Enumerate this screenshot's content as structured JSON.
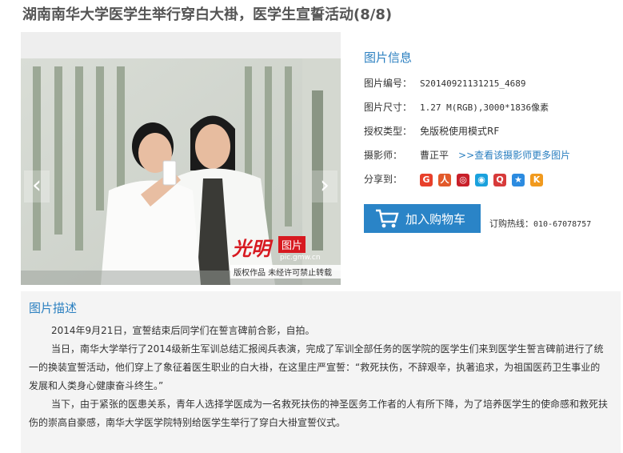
{
  "page": {
    "title": "湖南南华大学医学生举行穿白大褂，医学生宣誓活动(8/8)"
  },
  "viewer": {
    "prev_glyph": "‹",
    "next_glyph": "›",
    "watermark": {
      "logo_text": "光明",
      "pic_label": "图片",
      "url": "pic.gmw.cn",
      "copyright": "版权作品  未经许可禁止转载"
    }
  },
  "info": {
    "heading": "图片信息",
    "rows": [
      {
        "label": "图片编号：",
        "value": "S20140921131215_4689"
      },
      {
        "label": "图片尺寸：",
        "value": "1.27 M(RGB),3000*1836像素"
      },
      {
        "label": "授权类型：",
        "value": "免版税使用模式RF"
      },
      {
        "label": "摄影师：",
        "value": "曹正平",
        "link": ">>查看该摄影师更多图片"
      },
      {
        "label": "分享到："
      }
    ],
    "share": [
      {
        "name": "share-sina-weibo-icon",
        "glyph": "G",
        "color": "#e8402b"
      },
      {
        "name": "share-renren-icon",
        "glyph": "人",
        "color": "#e25a2b"
      },
      {
        "name": "share-tencent-weibo-icon",
        "glyph": "◎",
        "color": "#c8202a"
      },
      {
        "name": "share-qzone-icon",
        "glyph": "◉",
        "color": "#1aa1dd"
      },
      {
        "name": "share-qq-icon",
        "glyph": "Q",
        "color": "#d73a3a"
      },
      {
        "name": "share-star-icon",
        "glyph": "★",
        "color": "#2c8be0"
      },
      {
        "name": "share-kaixin-icon",
        "glyph": "K",
        "color": "#f19a1e"
      }
    ],
    "cart_button": "加入购物车",
    "hotline_label": "订购热线：",
    "hotline_number": "010-67078757"
  },
  "description": {
    "heading": "图片描述",
    "paragraphs": [
      "2014年9月21日，宣誓结束后同学们在誓言碑前合影，自拍。",
      "当日，南华大学举行了2014级新生军训总结汇报阅兵表演，完成了军训全部任务的医学院的医学生们来到医学生誓言碑前进行了统一的换装宣誓活动，他们穿上了象征着医生职业的白大褂，在这里庄严宣誓：“救死扶伤，不辞艰辛，执著追求，为祖国医药卫生事业的发展和人类身心健康奋斗终生。”",
      "当下，由于紧张的医患关系，青年人选择学医成为一名救死扶伤的神圣医务工作者的人有所下降，为了培养医学生的使命感和救死扶伤的崇高自豪感，南华大学医学院特别给医学生举行了穿白大褂宣誓仪式。"
    ]
  },
  "colors": {
    "accent": "#2a7fc0",
    "button": "#2a84c7",
    "desc_background": "#f4f4f4"
  }
}
